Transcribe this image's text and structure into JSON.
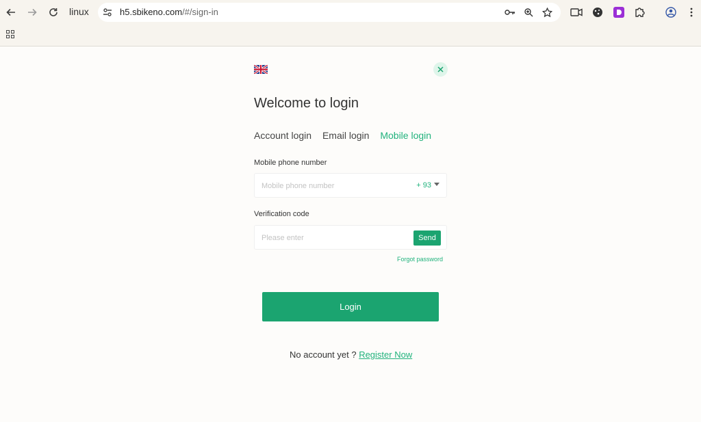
{
  "browser": {
    "tab_label": "linux",
    "url_host": "h5.sbikeno.com",
    "url_path": "/#/sign-in"
  },
  "page": {
    "title": "Welcome to login",
    "tabs": [
      {
        "label": "Account login",
        "active": false
      },
      {
        "label": "Email login",
        "active": false
      },
      {
        "label": "Mobile login",
        "active": true
      }
    ],
    "phone": {
      "label": "Mobile phone number",
      "placeholder": "Mobile phone number",
      "value": "",
      "country_code": "+ 93"
    },
    "code": {
      "label": "Verification code",
      "placeholder": "Please enter",
      "value": "",
      "send_label": "Send"
    },
    "forgot_label": "Forgot password",
    "login_label": "Login",
    "no_account_text": "No account yet ?",
    "register_label": "Register Now"
  },
  "colors": {
    "accent": "#1ba470",
    "accent_text": "#20b27c"
  },
  "icons": [
    "back-icon",
    "forward-icon",
    "reload-icon",
    "site-info-icon",
    "key-icon",
    "zoom-icon",
    "star-icon",
    "video-icon",
    "cookie-icon",
    "extension-d-icon",
    "puzzle-icon",
    "profile-icon",
    "menu-icon",
    "apps-icon",
    "uk-flag-icon",
    "close-icon"
  ]
}
